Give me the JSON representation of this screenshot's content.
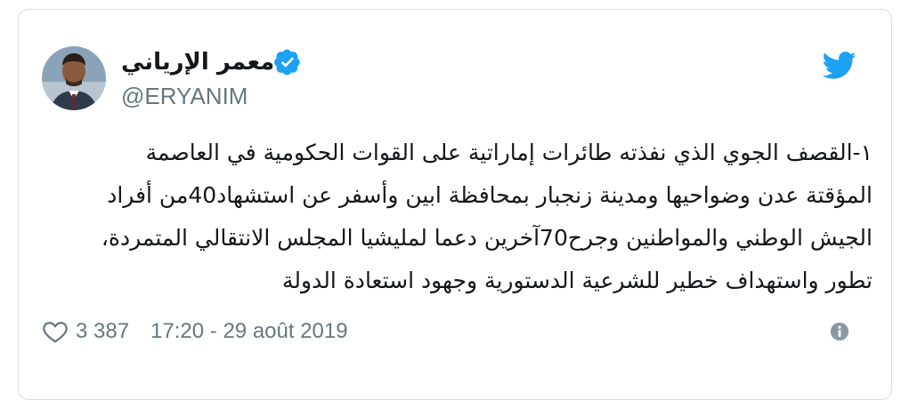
{
  "author": {
    "display_name": "معمر الإرياني",
    "handle": "@ERYANIM",
    "verified": true,
    "avatar_icon": "profile-photo-icon"
  },
  "tweet": {
    "lines": [
      "١-القصف الجوي الذي نفذته طائرات إماراتية على القوات الحكومية في العاصمة",
      "المؤقتة عدن وضواحيها ومدينة زنجبار بمحافظة ابين وأسفر عن استشهاد40من أفراد",
      "الجيش الوطني والمواطنين وجرح70آخرين دعما لمليشيا المجلس الانتقالي المتمردة،",
      "تطور واستهداف خطير للشرعية الدستورية وجهود استعادة الدولة"
    ]
  },
  "meta": {
    "likes": "3 387",
    "timestamp": "17:20 - 29 août 2019"
  },
  "icons": {
    "brand": "twitter-bird-icon",
    "like": "heart-icon",
    "info": "info-icon",
    "verified": "verified-badge-icon"
  },
  "colors": {
    "brand_blue": "#1da1f2",
    "text": "#14171a",
    "muted": "#657786",
    "border": "#d6dde3"
  }
}
